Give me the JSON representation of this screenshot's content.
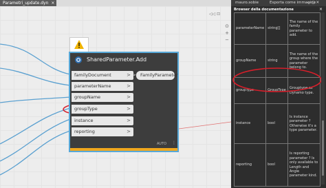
{
  "tab": {
    "filename": "Parametri_update.dyn",
    "close": "×"
  },
  "canvas_ctrls": {
    "icon1": "◁◁",
    "icon2": "⊡"
  },
  "zoom": {
    "fit": "⊙",
    "plus": "+",
    "minus": "−"
  },
  "node": {
    "title": "SharedParameter.Add",
    "inputs": [
      "familyDocument",
      "parameterName",
      "groupName",
      "groupType",
      "instance",
      "reporting"
    ],
    "output": "FamilyParameter",
    "run_mode": "AUTO",
    "menu": "⋮"
  },
  "panel": {
    "user": "mauro.sobie",
    "export": "Esporta come immagine",
    "window_btns": "— ◻ ✕",
    "title": "Browser della documentazione",
    "close": "×",
    "rows": [
      {
        "name": "parameterName",
        "type": "string[]",
        "desc": "The name of the family parameter to add."
      },
      {
        "name": "groupName",
        "type": "string",
        "desc": "The name of the group where the parameter belong to."
      },
      {
        "name": "groupType",
        "type": "GroupType",
        "desc": "Grouptype as Dynamo type."
      },
      {
        "name": "instance",
        "type": "bool",
        "desc": "Is instance parameter ? Otherwise it's a type parameter."
      },
      {
        "name": "reporting",
        "type": "bool",
        "desc": "Is reporting parameter ? Is only available to Length and Angle parameter kind."
      }
    ]
  },
  "colors": {
    "accent": "#57a8d8",
    "highlight": "#d81e2a",
    "warning": "#f0b400",
    "node_bar": "#f0a81e"
  }
}
